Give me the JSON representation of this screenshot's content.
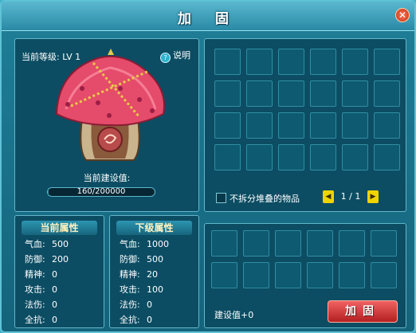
{
  "window": {
    "title": "加 固"
  },
  "building": {
    "level_label": "当前等级: LV 1",
    "help_label": "说明",
    "build_label": "当前建设值:",
    "progress_text": "160/200000",
    "progress_value": 160,
    "progress_max": 200000
  },
  "current_attributes": {
    "title": "当前属性",
    "rows": [
      {
        "k": "气血:",
        "v": "500"
      },
      {
        "k": "防御:",
        "v": "200"
      },
      {
        "k": "精神:",
        "v": "0"
      },
      {
        "k": "攻击:",
        "v": "0"
      },
      {
        "k": "法伤:",
        "v": "0"
      },
      {
        "k": "全抗:",
        "v": "0"
      }
    ]
  },
  "next_attributes": {
    "title": "下级属性",
    "rows": [
      {
        "k": "气血:",
        "v": "1000"
      },
      {
        "k": "防御:",
        "v": "500"
      },
      {
        "k": "精神:",
        "v": "20"
      },
      {
        "k": "攻击:",
        "v": "100"
      },
      {
        "k": "法伤:",
        "v": "0"
      },
      {
        "k": "全抗:",
        "v": "0"
      }
    ]
  },
  "inventory": {
    "no_split_label": "不拆分堆叠的物品",
    "page_text": "1 / 1"
  },
  "materials": {
    "build_value_label": "建设值+0",
    "reinforce_button": "加固"
  },
  "colors": {
    "accent": "#f0d400",
    "button": "#d93b3b"
  }
}
